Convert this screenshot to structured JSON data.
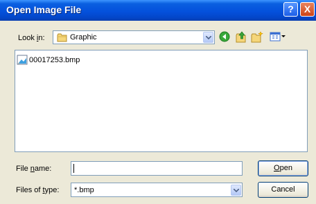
{
  "window": {
    "title": "Open Image File",
    "help_button": "?",
    "close_button": "X"
  },
  "lookin": {
    "label_pre": "Look ",
    "label_accel": "i",
    "label_post": "n:",
    "value": "Graphic"
  },
  "toolbar": {
    "icons": [
      "back-icon",
      "up-folder-icon",
      "new-folder-icon",
      "views-menu-icon"
    ]
  },
  "files": [
    {
      "name": "00017253.bmp",
      "icon": "bitmap-file-icon"
    }
  ],
  "filename": {
    "label_pre": "File ",
    "label_accel": "n",
    "label_post": "ame:",
    "value": ""
  },
  "filetype": {
    "label_pre": "Files of ",
    "label_accel": "t",
    "label_post": "ype:",
    "value": "*.bmp"
  },
  "buttons": {
    "open_accel": "O",
    "open_rest": "pen",
    "cancel": "Cancel"
  },
  "colors": {
    "titlebar": "#0451dc",
    "dialog_bg": "#ece9d8",
    "field_border": "#7f9db9",
    "button_border": "#003c74"
  }
}
